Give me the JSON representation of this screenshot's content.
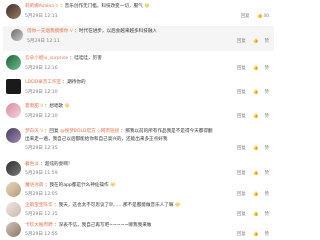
{
  "actions": {
    "reply": "回复",
    "like": "赞"
  },
  "comments": [
    {
      "name": "莉莉娜Azalea",
      "badge": "V",
      "text": "：音乐创作无门槛，科技改变一切，服气",
      "emoji": "😂",
      "time": "5月29日 12:11",
      "likes": "40"
    },
    {
      "name": "借你一支烟我摸摸你",
      "badge": "V",
      "text": "：时代在进步，以后会越来越多科技融入",
      "time": "5月29日 12:11"
    },
    {
      "name": "云朵小姐lx_surprise",
      "text": "：哇哇哇，厉害",
      "time": "5月29日 12:16"
    },
    {
      "name": "LDDD录音工作室",
      "text": "：期待你的",
      "time": "5月29日 12:10"
    },
    {
      "name": "夏雨甜",
      "badge": "V",
      "text": "：想唱歌",
      "emoji": "😆",
      "time": "5月29日 12:10"
    },
    {
      "name": "梦白天",
      "badge": "V",
      "text_prefix": "：回复",
      "mention": "@搜梦BOLD官方",
      "link": "◇网页链接",
      "text_suffix": "：那我以前的所有作品我是不是得今天都得翻",
      "text_line2": "出来走一遍，我自己以后都能给你和自己高兴的，还能出来多正点好我",
      "time": "5月29日 12:35"
    },
    {
      "name": "暮色淡",
      "text": "：超炫的耍啊！",
      "time": "5月29日 11:59"
    },
    {
      "name": "魔语冰萌",
      "text": "：我在的app都是什么神仙操作",
      "emoji": "😂",
      "time": "5月29日 12:05"
    },
    {
      "name": "企鹅宝宝陈华",
      "text": "：我天，这也太不可思议了叭……那不是都能做音乐人了嘛",
      "emoji": "😂",
      "time": "5月29日 12:35"
    },
    {
      "name": "卡钦大嫂周聘",
      "text": "：深表不信，我自己再写吧~~~~~哪我我来做",
      "time": "5月29日 12:55"
    }
  ]
}
